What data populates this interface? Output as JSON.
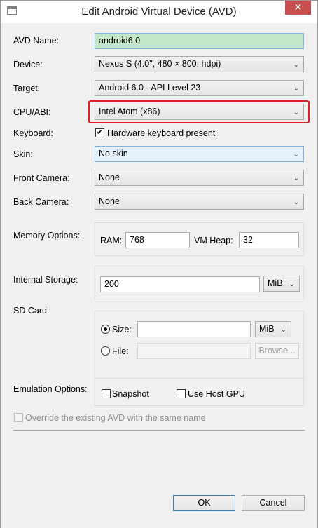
{
  "window": {
    "title": "Edit Android Virtual Device (AVD)",
    "close_glyph": "✕",
    "icon": "app-window-icon"
  },
  "form": {
    "avd_name": {
      "label": "AVD Name:",
      "value": "android6.0"
    },
    "device": {
      "label": "Device:",
      "value": "Nexus S (4.0\", 480 × 800: hdpi)"
    },
    "target": {
      "label": "Target:",
      "value": "Android 6.0 - API Level 23"
    },
    "cpu_abi": {
      "label": "CPU/ABI:",
      "value": "Intel Atom (x86)"
    },
    "keyboard": {
      "label": "Keyboard:",
      "checkbox_label": "Hardware keyboard present",
      "checked": true
    },
    "skin": {
      "label": "Skin:",
      "value": "No skin"
    },
    "front_camera": {
      "label": "Front Camera:",
      "value": "None"
    },
    "back_camera": {
      "label": "Back Camera:",
      "value": "None"
    },
    "memory": {
      "label": "Memory Options:",
      "ram_label": "RAM:",
      "ram_value": "768",
      "vm_heap_label": "VM Heap:",
      "vm_heap_value": "32"
    },
    "internal_storage": {
      "label": "Internal Storage:",
      "value": "200",
      "unit": "MiB"
    },
    "sd_card": {
      "label": "SD Card:",
      "size_label": "Size:",
      "size_value": "",
      "size_unit": "MiB",
      "file_label": "File:",
      "file_value": "",
      "browse_label": "Browse...",
      "selected": "size"
    },
    "emulation": {
      "label": "Emulation Options:",
      "snapshot_label": "Snapshot",
      "host_gpu_label": "Use Host GPU"
    },
    "override": {
      "label": "Override the existing AVD with the same name"
    }
  },
  "buttons": {
    "ok": "OK",
    "cancel": "Cancel"
  },
  "dropdown_arrow": "⌄",
  "colors": {
    "highlight": "#e02020",
    "name_field_bg": "#c4e9c9",
    "close_button": "#c74f4f"
  }
}
